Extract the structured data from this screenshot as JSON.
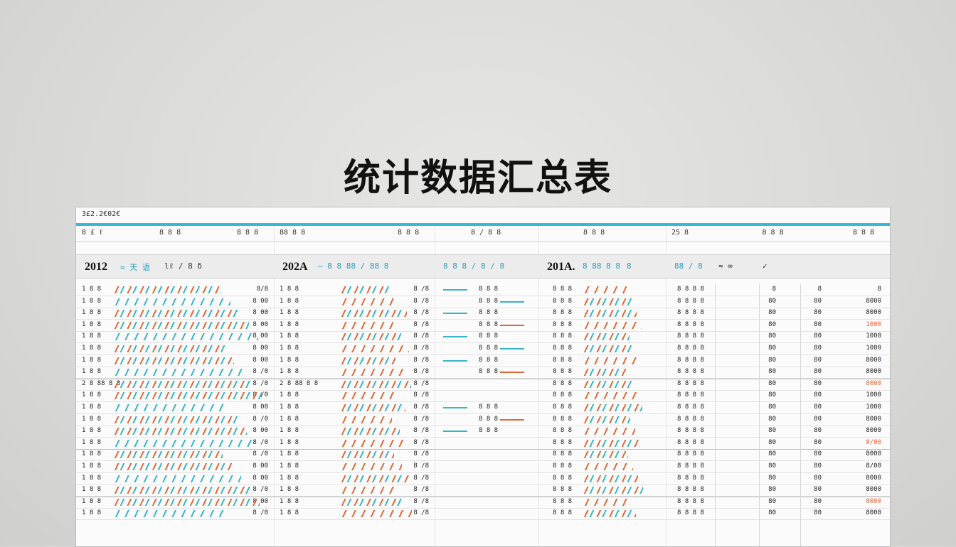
{
  "title": "统计数据汇总表",
  "columns": [
    {
      "top": "3£2.2€02€",
      "sub": [
        "8 £ ℓ",
        "8 8 8",
        "8 8 8"
      ],
      "year": "2012",
      "notes": [
        {
          "t": "≈ 天 语",
          "c": "teal"
        },
        {
          "t": "lℓ / 8 δ",
          "c": "dark"
        }
      ]
    },
    {
      "top": "",
      "sub": [
        "88 8 8",
        "8 8 8"
      ],
      "year": "202A",
      "notes": [
        {
          "t": "— 8 8 88 / 88 8",
          "c": "teal"
        }
      ]
    },
    {
      "top": "",
      "sub": [
        "8 / 8 8"
      ],
      "year": "",
      "notes": [
        {
          "t": "8 8 8 / 8 / 8",
          "c": "teal"
        }
      ]
    },
    {
      "top": "",
      "sub": [
        "8 8 8"
      ],
      "year": "201A.",
      "notes": [
        {
          "t": "8 88 8 8",
          "c": "teal"
        },
        {
          "t": "8",
          "c": "teal"
        }
      ]
    },
    {
      "top": "",
      "sub": [
        "25 8",
        "8 8 8",
        "8 8 8"
      ],
      "year": "",
      "notes": [
        {
          "t": "88 / 8",
          "c": "teal"
        },
        {
          "t": "≈ ∞",
          "c": "dark"
        },
        {
          "t": "✓",
          "c": "dark"
        }
      ]
    }
  ],
  "rows_left": [
    {
      "l": "1 8 8",
      "n": "8/8"
    },
    {
      "l": "1 8 8",
      "n": "8 00"
    },
    {
      "l": "1 8 8",
      "n": "8 00"
    },
    {
      "l": "1 8 8",
      "n": "8 00"
    },
    {
      "l": "1 8 8",
      "n": "8 00"
    },
    {
      "l": "1 8 8",
      "n": "8 00"
    },
    {
      "l": "1 8 8",
      "n": "8 00"
    },
    {
      "l": "1 8 8",
      "n": "8 /0"
    },
    {
      "l": "2 8 88 8 8",
      "n": "8 /0"
    },
    {
      "l": "1 8 8",
      "n": "8 /0"
    },
    {
      "l": "1 8 8",
      "n": "8 00"
    },
    {
      "l": "1 8 8",
      "n": "8 /0"
    },
    {
      "l": "1 8 8",
      "n": "8 00"
    },
    {
      "l": "1 8 8",
      "n": "8 /0"
    },
    {
      "l": "1 8 8",
      "n": "8 /0"
    },
    {
      "l": "1 8 8",
      "n": "8 00"
    },
    {
      "l": "1 8 8",
      "n": "8 00"
    },
    {
      "l": "1 8 8",
      "n": "8 /0"
    },
    {
      "l": "1 8 8",
      "n": "8 00"
    },
    {
      "l": "1 8 8",
      "n": "8 /0"
    }
  ],
  "rows_right": [
    {
      "l": "8 8 8 8",
      "a": "8",
      "b": "8",
      "c": "8"
    },
    {
      "l": "8 8 8 8",
      "a": "80",
      "b": "80",
      "c": "8000"
    },
    {
      "l": "8 8 8 8",
      "a": "80",
      "b": "80",
      "c": "8000"
    },
    {
      "l": "8 8 8 8",
      "a": "80",
      "b": "80",
      "c": "1000"
    },
    {
      "l": "8 8 8 8",
      "a": "80",
      "b": "80",
      "c": "1000"
    },
    {
      "l": "8 8 8 8",
      "a": "80",
      "b": "80",
      "c": "1000"
    },
    {
      "l": "8 8 8 8",
      "a": "80",
      "b": "80",
      "c": "8000"
    },
    {
      "l": "8 8 8 8",
      "a": "80",
      "b": "80",
      "c": "8000"
    },
    {
      "l": "8 8 8 8",
      "a": "80",
      "b": "80",
      "c": "8000"
    },
    {
      "l": "8 8 8 8",
      "a": "80",
      "b": "80",
      "c": "1000"
    },
    {
      "l": "8 8 8 8",
      "a": "80",
      "b": "80",
      "c": "1000"
    },
    {
      "l": "8 8 8 8",
      "a": "80",
      "b": "80",
      "c": "8000"
    },
    {
      "l": "8 8 8 8",
      "a": "80",
      "b": "80",
      "c": "8000"
    },
    {
      "l": "8 8 8 8",
      "a": "80",
      "b": "80",
      "c": "8/00"
    },
    {
      "l": "8 8 8 8",
      "a": "80",
      "b": "80",
      "c": "8000"
    },
    {
      "l": "8 8 8 8",
      "a": "80",
      "b": "80",
      "c": "8/00"
    },
    {
      "l": "8 8 8 8",
      "a": "80",
      "b": "80",
      "c": "8000"
    },
    {
      "l": "8 8 8 8",
      "a": "80",
      "b": "80",
      "c": "8000"
    },
    {
      "l": "8 8 8 8",
      "a": "80",
      "b": "80",
      "c": "8000"
    },
    {
      "l": "8 8 8 8",
      "a": "80",
      "b": "80",
      "c": "8000"
    }
  ],
  "colors": {
    "accent": "#36b8d6",
    "hatch_orange": "#e0693a",
    "hatch_teal": "#38b6c8"
  }
}
